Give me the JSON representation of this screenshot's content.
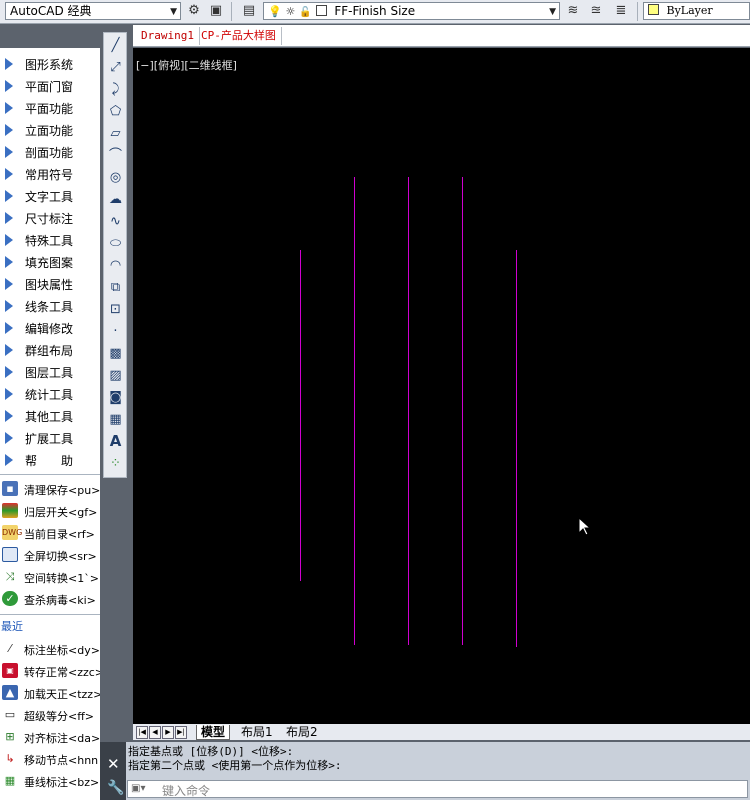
{
  "toolbar": {
    "workspace": "AutoCAD 经典",
    "layer": "FF-Finish Size",
    "color": "ByLayer"
  },
  "menu": [
    "图形系统",
    "平面门窗",
    "平面功能",
    "立面功能",
    "剖面功能",
    "常用符号",
    "文字工具",
    "尺寸标注",
    "特殊工具",
    "填充图案",
    "图块属性",
    "线条工具",
    "编辑修改",
    "群组布局",
    "图层工具",
    "统计工具",
    "其他工具",
    "扩展工具",
    "帮　　助"
  ],
  "commands": [
    {
      "label": "清理保存<pu>",
      "icon": "save-icon"
    },
    {
      "label": "归层开关<gf>",
      "icon": "layers-icon"
    },
    {
      "label": "当前目录<rf>",
      "icon": "dwg-folder-icon"
    },
    {
      "label": "全屏切换<sr>",
      "icon": "fullscreen-icon"
    },
    {
      "label": "空间转换<1`>",
      "icon": "space-convert-icon"
    },
    {
      "label": "查杀病毒<ki>",
      "icon": "shield-icon"
    }
  ],
  "recent_label": "最近",
  "recent": [
    {
      "label": "标注坐标<dy>",
      "icon": "coordinate-icon"
    },
    {
      "label": "转存正常<zzc>",
      "icon": "convert-save-icon"
    },
    {
      "label": "加载天正<tzz>",
      "icon": "load-icon"
    },
    {
      "label": "超级等分<ff>",
      "icon": "divide-icon"
    },
    {
      "label": "对齐标注<da>",
      "icon": "align-dim-icon"
    },
    {
      "label": "移动节点<hnn",
      "icon": "move-node-icon"
    },
    {
      "label": "垂线标注<bz>",
      "icon": "grid-icon"
    }
  ],
  "doc_tabs": [
    "Drawing1",
    "CP-产品大样图"
  ],
  "view_label": "[−][俯视][二维线框]",
  "layout_tabs": [
    "模型",
    "布局1",
    "布局2"
  ],
  "command_history": [
    "指定基点或 [位移(D)] <位移>:",
    "指定第二个点或 <使用第一个点作为位移>:"
  ],
  "command_placeholder": "键入命令",
  "colors": {
    "line": "#d000d0",
    "canvas": "#000000",
    "menu_arrow": "#3a6fc2"
  }
}
